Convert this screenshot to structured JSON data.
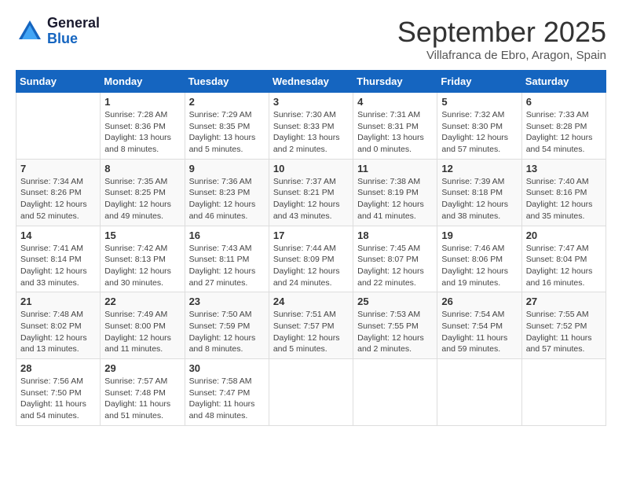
{
  "header": {
    "logo_general": "General",
    "logo_blue": "Blue",
    "month_title": "September 2025",
    "location": "Villafranca de Ebro, Aragon, Spain"
  },
  "days_of_week": [
    "Sunday",
    "Monday",
    "Tuesday",
    "Wednesday",
    "Thursday",
    "Friday",
    "Saturday"
  ],
  "weeks": [
    [
      {
        "day": "",
        "info": ""
      },
      {
        "day": "1",
        "info": "Sunrise: 7:28 AM\nSunset: 8:36 PM\nDaylight: 13 hours\nand 8 minutes."
      },
      {
        "day": "2",
        "info": "Sunrise: 7:29 AM\nSunset: 8:35 PM\nDaylight: 13 hours\nand 5 minutes."
      },
      {
        "day": "3",
        "info": "Sunrise: 7:30 AM\nSunset: 8:33 PM\nDaylight: 13 hours\nand 2 minutes."
      },
      {
        "day": "4",
        "info": "Sunrise: 7:31 AM\nSunset: 8:31 PM\nDaylight: 13 hours\nand 0 minutes."
      },
      {
        "day": "5",
        "info": "Sunrise: 7:32 AM\nSunset: 8:30 PM\nDaylight: 12 hours\nand 57 minutes."
      },
      {
        "day": "6",
        "info": "Sunrise: 7:33 AM\nSunset: 8:28 PM\nDaylight: 12 hours\nand 54 minutes."
      }
    ],
    [
      {
        "day": "7",
        "info": "Sunrise: 7:34 AM\nSunset: 8:26 PM\nDaylight: 12 hours\nand 52 minutes."
      },
      {
        "day": "8",
        "info": "Sunrise: 7:35 AM\nSunset: 8:25 PM\nDaylight: 12 hours\nand 49 minutes."
      },
      {
        "day": "9",
        "info": "Sunrise: 7:36 AM\nSunset: 8:23 PM\nDaylight: 12 hours\nand 46 minutes."
      },
      {
        "day": "10",
        "info": "Sunrise: 7:37 AM\nSunset: 8:21 PM\nDaylight: 12 hours\nand 43 minutes."
      },
      {
        "day": "11",
        "info": "Sunrise: 7:38 AM\nSunset: 8:19 PM\nDaylight: 12 hours\nand 41 minutes."
      },
      {
        "day": "12",
        "info": "Sunrise: 7:39 AM\nSunset: 8:18 PM\nDaylight: 12 hours\nand 38 minutes."
      },
      {
        "day": "13",
        "info": "Sunrise: 7:40 AM\nSunset: 8:16 PM\nDaylight: 12 hours\nand 35 minutes."
      }
    ],
    [
      {
        "day": "14",
        "info": "Sunrise: 7:41 AM\nSunset: 8:14 PM\nDaylight: 12 hours\nand 33 minutes."
      },
      {
        "day": "15",
        "info": "Sunrise: 7:42 AM\nSunset: 8:13 PM\nDaylight: 12 hours\nand 30 minutes."
      },
      {
        "day": "16",
        "info": "Sunrise: 7:43 AM\nSunset: 8:11 PM\nDaylight: 12 hours\nand 27 minutes."
      },
      {
        "day": "17",
        "info": "Sunrise: 7:44 AM\nSunset: 8:09 PM\nDaylight: 12 hours\nand 24 minutes."
      },
      {
        "day": "18",
        "info": "Sunrise: 7:45 AM\nSunset: 8:07 PM\nDaylight: 12 hours\nand 22 minutes."
      },
      {
        "day": "19",
        "info": "Sunrise: 7:46 AM\nSunset: 8:06 PM\nDaylight: 12 hours\nand 19 minutes."
      },
      {
        "day": "20",
        "info": "Sunrise: 7:47 AM\nSunset: 8:04 PM\nDaylight: 12 hours\nand 16 minutes."
      }
    ],
    [
      {
        "day": "21",
        "info": "Sunrise: 7:48 AM\nSunset: 8:02 PM\nDaylight: 12 hours\nand 13 minutes."
      },
      {
        "day": "22",
        "info": "Sunrise: 7:49 AM\nSunset: 8:00 PM\nDaylight: 12 hours\nand 11 minutes."
      },
      {
        "day": "23",
        "info": "Sunrise: 7:50 AM\nSunset: 7:59 PM\nDaylight: 12 hours\nand 8 minutes."
      },
      {
        "day": "24",
        "info": "Sunrise: 7:51 AM\nSunset: 7:57 PM\nDaylight: 12 hours\nand 5 minutes."
      },
      {
        "day": "25",
        "info": "Sunrise: 7:53 AM\nSunset: 7:55 PM\nDaylight: 12 hours\nand 2 minutes."
      },
      {
        "day": "26",
        "info": "Sunrise: 7:54 AM\nSunset: 7:54 PM\nDaylight: 11 hours\nand 59 minutes."
      },
      {
        "day": "27",
        "info": "Sunrise: 7:55 AM\nSunset: 7:52 PM\nDaylight: 11 hours\nand 57 minutes."
      }
    ],
    [
      {
        "day": "28",
        "info": "Sunrise: 7:56 AM\nSunset: 7:50 PM\nDaylight: 11 hours\nand 54 minutes."
      },
      {
        "day": "29",
        "info": "Sunrise: 7:57 AM\nSunset: 7:48 PM\nDaylight: 11 hours\nand 51 minutes."
      },
      {
        "day": "30",
        "info": "Sunrise: 7:58 AM\nSunset: 7:47 PM\nDaylight: 11 hours\nand 48 minutes."
      },
      {
        "day": "",
        "info": ""
      },
      {
        "day": "",
        "info": ""
      },
      {
        "day": "",
        "info": ""
      },
      {
        "day": "",
        "info": ""
      }
    ]
  ]
}
